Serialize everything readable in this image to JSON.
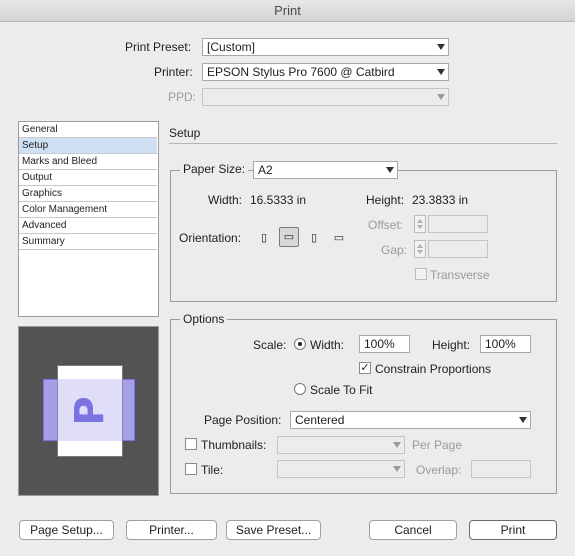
{
  "window": {
    "title": "Print"
  },
  "top": {
    "preset_label": "Print Preset:",
    "preset_value": "[Custom]",
    "printer_label": "Printer:",
    "printer_value": "EPSON Stylus Pro 7600 @ Catbird",
    "ppd_label": "PPD:",
    "ppd_value": ""
  },
  "sidebar": {
    "items": [
      {
        "label": "General"
      },
      {
        "label": "Setup"
      },
      {
        "label": "Marks and Bleed"
      },
      {
        "label": "Output"
      },
      {
        "label": "Graphics"
      },
      {
        "label": "Color Management"
      },
      {
        "label": "Advanced"
      },
      {
        "label": "Summary"
      }
    ],
    "selected": "Setup"
  },
  "section_title": "Setup",
  "paper": {
    "size_label": "Paper Size:",
    "size_value": "A2",
    "width_label": "Width:",
    "width_value": "16.5333 in",
    "height_label": "Height:",
    "height_value": "23.3833 in",
    "orientation_label": "Orientation:",
    "offset_label": "Offset:",
    "gap_label": "Gap:",
    "transverse_label": "Transverse"
  },
  "options": {
    "legend": "Options",
    "scale_label": "Scale:",
    "width_radio_label": "Width:",
    "width_value": "100%",
    "height_label": "Height:",
    "height_value": "100%",
    "constrain_label": "Constrain Proportions",
    "constrain_checked": true,
    "scale_to_fit_label": "Scale To Fit",
    "page_position_label": "Page Position:",
    "page_position_value": "Centered",
    "thumbnails_label": "Thumbnails:",
    "per_page_label": "Per Page",
    "tile_label": "Tile:",
    "overlap_label": "Overlap:"
  },
  "preview": {
    "glyph": "P"
  },
  "buttons": {
    "page_setup": "Page Setup...",
    "printer": "Printer...",
    "save_preset": "Save Preset...",
    "cancel": "Cancel",
    "print": "Print"
  },
  "colors": {
    "selection": "#cfe0f5",
    "preview_bg": "#535353",
    "preview_accent": "#7b74e0"
  }
}
